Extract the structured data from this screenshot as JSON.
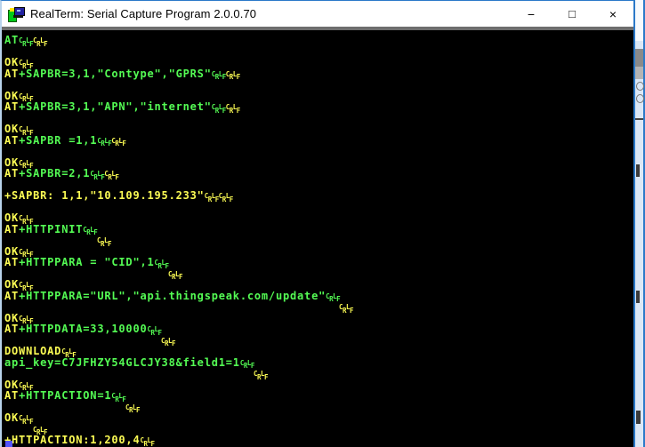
{
  "window": {
    "title": "RealTerm: Serial Capture Program 2.0.0.70",
    "controls": {
      "minimize": "−",
      "maximize": "□",
      "close": "×"
    }
  },
  "colors": {
    "terminal_bg": "#000000",
    "titlebar_bg": "#ffffff",
    "border_blue": "#2b79c9",
    "cursor_blue": "#5454fc",
    "map": {
      "g": "#54fc54",
      "y": "#fcfc54"
    }
  },
  "terminal": {
    "cursor_visible": true,
    "lines": [
      [
        {
          "t": "AT",
          "c": "g"
        },
        {
          "cc": "g"
        },
        {
          "cc": "y"
        }
      ],
      [],
      [
        {
          "t": "OK",
          "c": "y"
        },
        {
          "cc": "y"
        }
      ],
      [
        {
          "t": "AT",
          "c": "y"
        },
        {
          "t": "+SAPBR=3,1,\"Contype\",\"GPRS\"",
          "c": "g"
        },
        {
          "cc": "g"
        },
        {
          "cc": "y"
        }
      ],
      [],
      [
        {
          "t": "OK",
          "c": "y"
        },
        {
          "cc": "y"
        }
      ],
      [
        {
          "t": "AT",
          "c": "y"
        },
        {
          "t": "+SAPBR=3,1,\"APN\",\"internet\"",
          "c": "g"
        },
        {
          "cc": "g"
        },
        {
          "cc": "y"
        }
      ],
      [],
      [
        {
          "t": "OK",
          "c": "y"
        },
        {
          "cc": "y"
        }
      ],
      [
        {
          "t": "AT",
          "c": "y"
        },
        {
          "t": "+SAPBR =1,1",
          "c": "g"
        },
        {
          "cc": "g"
        },
        {
          "cc": "y"
        }
      ],
      [],
      [
        {
          "t": "OK",
          "c": "y"
        },
        {
          "cc": "y"
        }
      ],
      [
        {
          "t": "AT",
          "c": "y"
        },
        {
          "t": "+SAPBR=2,1",
          "c": "g"
        },
        {
          "cc": "g"
        },
        {
          "cc": "y"
        }
      ],
      [],
      [
        {
          "t": "+SAPBR: 1,1,\"10.109.195.233\"",
          "c": "y"
        },
        {
          "cc": "y"
        },
        {
          "cc": "y"
        }
      ],
      [],
      [
        {
          "t": "OK",
          "c": "y"
        },
        {
          "cc": "y"
        }
      ],
      [
        {
          "t": "AT",
          "c": "y"
        },
        {
          "t": "+HTTPINIT",
          "c": "g"
        },
        {
          "cc": "g"
        }
      ],
      [
        {
          "pad": 13
        },
        {
          "cc": "y"
        }
      ],
      [
        {
          "t": "OK",
          "c": "y"
        },
        {
          "cc": "y"
        }
      ],
      [
        {
          "t": "AT",
          "c": "y"
        },
        {
          "t": "+HTTPPARA = \"CID\",1",
          "c": "g"
        },
        {
          "cc": "g"
        }
      ],
      [
        {
          "pad": 23
        },
        {
          "cc": "y"
        }
      ],
      [
        {
          "t": "OK",
          "c": "y"
        },
        {
          "cc": "y"
        }
      ],
      [
        {
          "t": "AT",
          "c": "y"
        },
        {
          "t": "+HTTPPARA=\"URL\",\"api.thingspeak.com/update\"",
          "c": "g"
        },
        {
          "cc": "g"
        }
      ],
      [
        {
          "pad": 47
        },
        {
          "cc": "y"
        }
      ],
      [
        {
          "t": "OK",
          "c": "y"
        },
        {
          "cc": "y"
        }
      ],
      [
        {
          "t": "AT",
          "c": "y"
        },
        {
          "t": "+HTTPDATA=33,10000",
          "c": "g"
        },
        {
          "cc": "g"
        }
      ],
      [
        {
          "pad": 22
        },
        {
          "cc": "y"
        }
      ],
      [
        {
          "t": "DOWNLOAD",
          "c": "y"
        },
        {
          "cc": "y"
        }
      ],
      [
        {
          "t": "api_key=C7JFHZY54GLCJY38&field1=1",
          "c": "g"
        },
        {
          "cc": "g"
        }
      ],
      [
        {
          "pad": 35
        },
        {
          "cc": "y"
        }
      ],
      [
        {
          "t": "OK",
          "c": "y"
        },
        {
          "cc": "y"
        }
      ],
      [
        {
          "t": "AT",
          "c": "y"
        },
        {
          "t": "+HTTPACTION=1",
          "c": "g"
        },
        {
          "cc": "g"
        }
      ],
      [
        {
          "pad": 17
        },
        {
          "cc": "y"
        }
      ],
      [
        {
          "t": "OK",
          "c": "y"
        },
        {
          "cc": "y"
        }
      ],
      [
        {
          "pad": 4
        },
        {
          "cc": "y"
        }
      ],
      [
        {
          "t": "+HTTPACTION:1,200,4",
          "c": "y"
        },
        {
          "cc": "y"
        }
      ]
    ]
  }
}
